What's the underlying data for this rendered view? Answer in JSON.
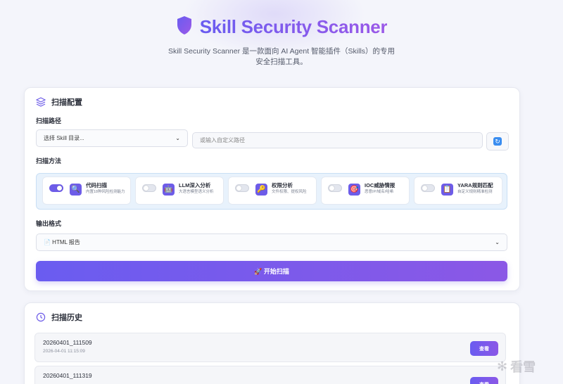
{
  "header": {
    "title": "Skill Security Scanner",
    "subtitle": "Skill Security Scanner 是一款面向 AI Agent 智能插件（Skills）的专用安全扫描工具。"
  },
  "config": {
    "title": "扫描配置",
    "scan_path_label": "扫描路径",
    "skill_dir_select": "选择 Skill 目录...",
    "custom_path_placeholder": "或输入自定义路径",
    "scan_method_label": "扫描方法",
    "methods": [
      {
        "name": "代码扫描",
        "desc": "内置18种风险检测能力",
        "enabled": true,
        "icon": "magnifier-icon",
        "glyph": "🔍"
      },
      {
        "name": "LLM深入分析",
        "desc": "大语言模型语义分析",
        "enabled": false,
        "icon": "robot-icon",
        "glyph": "🤖"
      },
      {
        "name": "权限分析",
        "desc": "文件权限、提权风险",
        "enabled": false,
        "icon": "key-icon",
        "glyph": "🔑"
      },
      {
        "name": "IOC威胁情报",
        "desc": "恶意IP/域名/哈希",
        "enabled": false,
        "icon": "target-icon",
        "glyph": "🎯"
      },
      {
        "name": "YARA规则匹配",
        "desc": "自定义规则精准检测",
        "enabled": false,
        "icon": "clipboard-icon",
        "glyph": "📋"
      }
    ],
    "output_format_label": "输出格式",
    "output_format_value": "📄 HTML 报告",
    "start_button": "🚀 开始扫描"
  },
  "history": {
    "title": "扫描历史",
    "items": [
      {
        "name": "20260401_111509",
        "time": "2026-04-01 11:15:09",
        "action": "查看"
      },
      {
        "name": "20260401_111319",
        "time": "",
        "action": "查看"
      }
    ]
  },
  "watermark": "看雪",
  "colors": {
    "accent": "#6d5ce8",
    "accent2": "#8b58e6",
    "methods_bg": "#e8f2fc"
  }
}
